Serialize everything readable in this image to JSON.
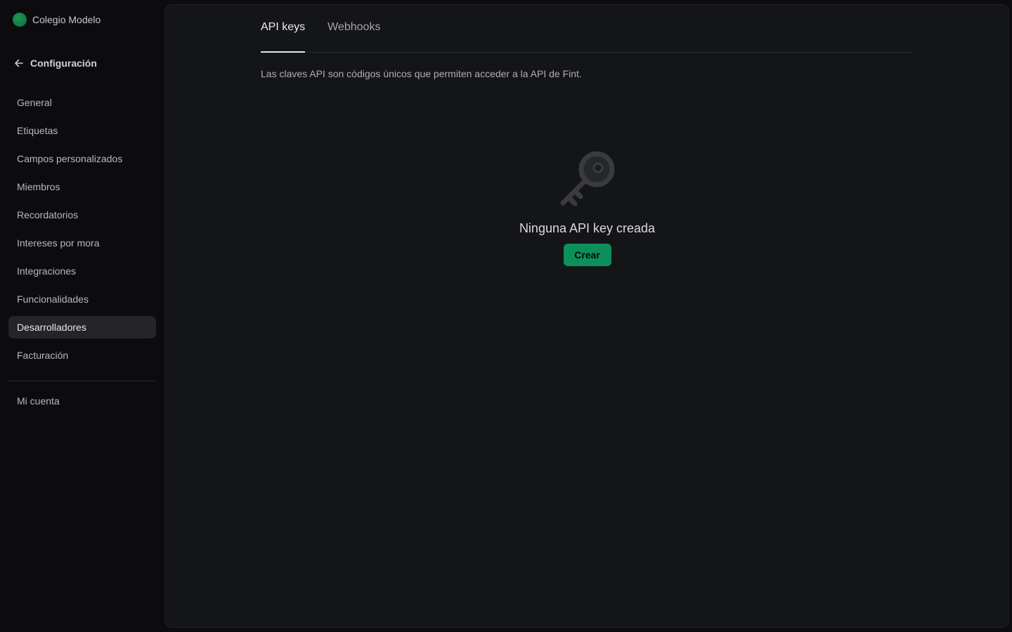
{
  "org": {
    "name": "Colegio Modelo",
    "logo_color": "#128a4a"
  },
  "sidebar": {
    "back_label": "Configuración",
    "items": [
      {
        "label": "General",
        "active": false
      },
      {
        "label": "Etiquetas",
        "active": false
      },
      {
        "label": "Campos personalizados",
        "active": false
      },
      {
        "label": "Miembros",
        "active": false
      },
      {
        "label": "Recordatorios",
        "active": false
      },
      {
        "label": "Intereses por mora",
        "active": false
      },
      {
        "label": "Integraciones",
        "active": false
      },
      {
        "label": "Funcionalidades",
        "active": false
      },
      {
        "label": "Desarrolladores",
        "active": true
      },
      {
        "label": "Facturación",
        "active": false
      }
    ],
    "account_label": "Mi cuenta"
  },
  "main": {
    "tabs": [
      {
        "label": "API keys",
        "active": true
      },
      {
        "label": "Webhooks",
        "active": false
      }
    ],
    "description": "Las claves API son códigos únicos que permiten acceder a la API de Fint.",
    "empty_state": {
      "icon": "key-icon",
      "title": "Ninguna API key creada",
      "button_label": "Crear"
    }
  },
  "colors": {
    "background": "#0c0c0e",
    "panel": "#141517",
    "accent": "#0d8f5c",
    "active_nav": "#252528"
  }
}
